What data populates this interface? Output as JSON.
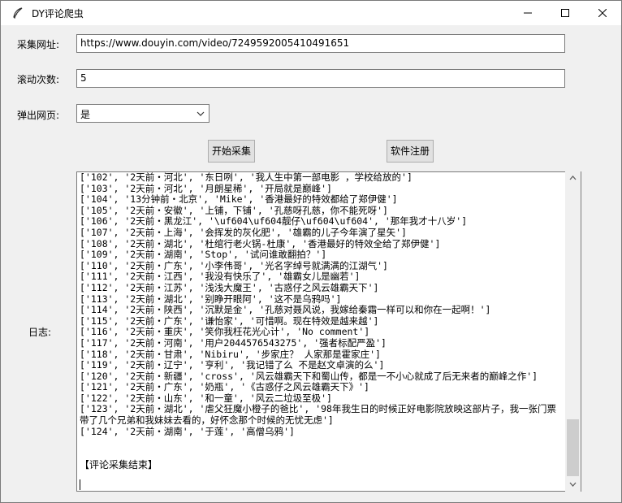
{
  "window": {
    "title": "DY评论爬虫",
    "icon": "feather-icon"
  },
  "form": {
    "url_label": "采集网址:",
    "url_value": "https://www.douyin.com/video/7249592005410491651",
    "scroll_label": "滚动次数:",
    "scroll_value": "5",
    "popup_label": "弹出网页:",
    "popup_value": "是"
  },
  "buttons": {
    "start": "开始采集",
    "register": "软件注册"
  },
  "log": {
    "label": "日志:",
    "lines": [
      "['102', '2天前・河北', '东日咧', '我人生中第一部电影 ，学校给放的']",
      "['103', '2天前・河北', '月朗星稀', '开局就是巅峰']",
      "['104', '13分钟前・北京', 'Mike', '香港最好的特效都给了郑伊健']",
      "['105', '2天前・安徽', '上铺，下铺', '孔慈呀孔慈，你不能死呀']",
      "['106', '2天前・黑龙江', '\\uf604\\uf604靓仔\\uf604\\uf604', '那年我才十八岁']",
      "['107', '2天前・上海', '会挥发的灰化肥', '雄霸的儿子今年演了星矢']",
      "['108', '2天前・湖北', '杜绾行老火锅-杜康', '香港最好的特效全给了郑伊健']",
      "['109', '2天前・湖南', 'Stop', '试问谁敢翻拍？']",
      "['110', '2天前・广东', '小李伟哥', '光名字绰号就满满的江湖气']",
      "['111', '2天前・江西', '我没有快乐了', '雄霸女儿是幽若']",
      "['112', '2天前・江苏', '浅浅大魔王', '古惑仔之风云雄霸天下']",
      "['113', '2天前・湖北', '别睁开眼阿', '这不是乌鸦吗']",
      "['114', '2天前・陕西', '沉默是金', '孔慈对聂风说，我嫁给秦霜一样可以和你在一起啊！']",
      "['115', '2天前・广东', '谦怡家', '可惜啊。现在特效是越来越']",
      "['116', '2天前・重庆', '笑你我枉花光心计', 'No comment']",
      "['117', '2天前・河南', '用户2044576543275', '强者标配严盈']",
      "['118', '2天前・甘肃', 'Nibiru', '步家庄？ 人家那是霍家庄']",
      "['119', '2天前・辽宁', '亨利', '我记错了么 不是赵文卓演的么']",
      "['120', '2天前・新疆', 'cross', '风云雄霸天下和蜀山传，都是一不小心就成了后无来者的巅峰之作']",
      "['121', '2天前・广东', '奶瓶', '《古惑仔之风云雄霸天下》']",
      "['122', '2天前・山东', '和一童', '风云二垃圾至极']",
      "['123', '2天前・湖北', '虐父狂魔小橙子的爸比', '98年我生日的时候正好电影院放映这部片子，我一张门票带了几个兄弟和我妹妹去看的，好怀念那个时候的无忧无虑']",
      "['124', '2天前・湖南', '于莲', '高僧乌鸦']"
    ],
    "end_message": "【评论采集结束】"
  }
}
